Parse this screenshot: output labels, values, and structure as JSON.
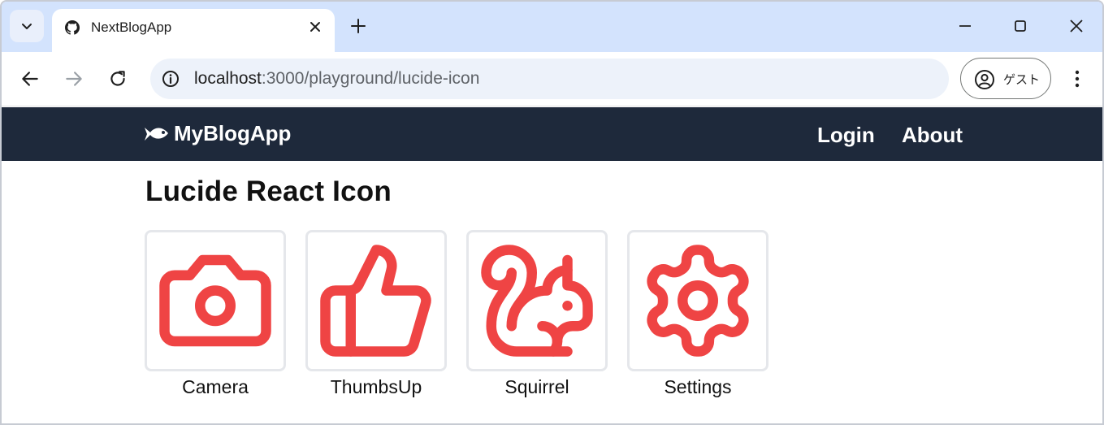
{
  "browser": {
    "tab_title": "NextBlogApp",
    "url_host": "localhost",
    "url_rest": ":3000/playground/lucide-icon",
    "profile_label": "ゲスト"
  },
  "navbar": {
    "brand": "MyBlogApp",
    "links": [
      {
        "label": "Login"
      },
      {
        "label": "About"
      }
    ],
    "background": "#1e293b"
  },
  "page": {
    "title": "Lucide React Icon",
    "icon_color": "#ef4444",
    "icons": [
      {
        "name": "Camera",
        "icon": "camera-icon"
      },
      {
        "name": "ThumbsUp",
        "icon": "thumbs-up-icon"
      },
      {
        "name": "Squirrel",
        "icon": "squirrel-icon"
      },
      {
        "name": "Settings",
        "icon": "settings-icon"
      }
    ]
  }
}
